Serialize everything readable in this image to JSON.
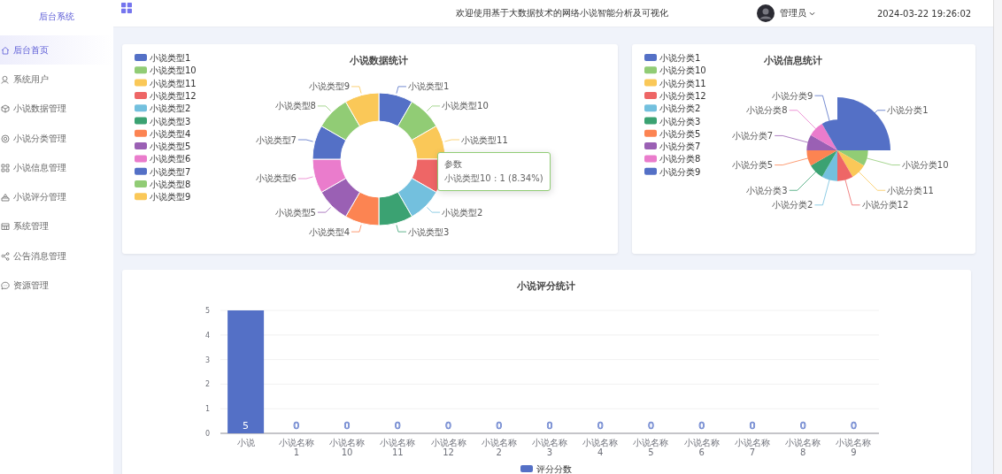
{
  "sidebar": {
    "title": "后台系统",
    "items": [
      {
        "label": "后台首页",
        "selected": true
      },
      {
        "label": "系统用户",
        "selected": false
      },
      {
        "label": "小说数据管理",
        "selected": false
      },
      {
        "label": "小说分类管理",
        "selected": false
      },
      {
        "label": "小说信息管理",
        "selected": false
      },
      {
        "label": "小说评分管理",
        "selected": false
      },
      {
        "label": "系统管理",
        "selected": false
      },
      {
        "label": "公告消息管理",
        "selected": false
      },
      {
        "label": "资源管理",
        "selected": false
      }
    ]
  },
  "header": {
    "title": "欢迎使用基于大数据技术的网络小说智能分析及可视化",
    "user": "管理员",
    "datetime": "2024-03-22 19:26:02"
  },
  "novel_data_card": {
    "chart_data": {
      "type": "donut",
      "title": "小说数据统计",
      "legend": "left",
      "categories": [
        "小说类型1",
        "小说类型10",
        "小说类型11",
        "小说类型12",
        "小说类型2",
        "小说类型3",
        "小说类型4",
        "小说类型5",
        "小说类型6",
        "小说类型7",
        "小说类型8",
        "小说类型9"
      ],
      "series": [
        {
          "name": "参数",
          "values": [
            1,
            1,
            1,
            1,
            1,
            1,
            1,
            1,
            1,
            1,
            1,
            1
          ]
        }
      ]
    },
    "tooltip": {
      "text": "小说类型10 : 1 (8.34%)",
      "color": "#91cc75"
    }
  },
  "novel_info_card": {
    "title": "小说信息统计",
    "legend": [
      "小说分类1",
      "小说分类10",
      "小说分类11",
      "小说分类12",
      "小说分类2",
      "小说分类3",
      "小说分类5",
      "小说分类7",
      "小说分类8",
      "小说分类9"
    ],
    "slice_labels": [
      "小说分类9",
      "小说分类8",
      "小说分类1",
      "小说分类7",
      "小说分类5",
      "小说分类10",
      "小说分类3",
      "小说分类11",
      "小说分类2",
      "小说分类12"
    ]
  },
  "rating_card": {
    "chart_data": {
      "type": "bar",
      "title": "小说评分统计",
      "legend": "bottom",
      "grid": true,
      "categories": [
        "小说",
        "小说名称\n1",
        "小说名称\n10",
        "小说名称\n11",
        "小说名称\n12",
        "小说名称\n2",
        "小说名称\n3",
        "小说名称\n4",
        "小说名称\n5",
        "小说名称\n6",
        "小说名称\n7",
        "小说名称\n8",
        "小说名称\n9"
      ],
      "series": [
        {
          "name": "评分分数",
          "color": "#5470c6",
          "values": [
            5,
            0,
            0,
            0,
            0,
            0,
            0,
            0,
            0,
            0,
            0,
            0,
            0
          ]
        }
      ],
      "ylim": [
        0,
        5
      ],
      "yticks": [
        0,
        1,
        2,
        3,
        4,
        5
      ],
      "data_labels": true
    }
  }
}
